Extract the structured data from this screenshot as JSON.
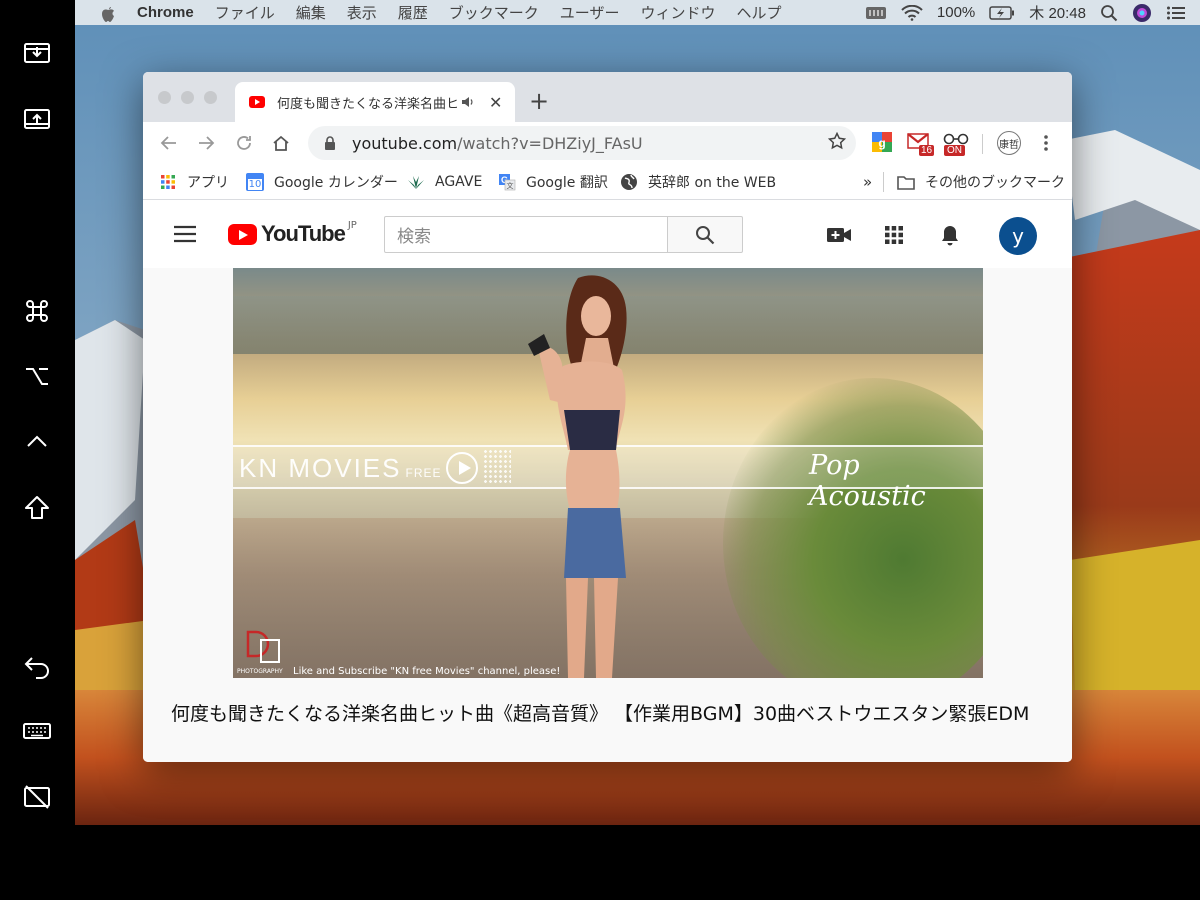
{
  "menubar": {
    "app_name": "Chrome",
    "menus": [
      "ファイル",
      "編集",
      "表示",
      "履歴",
      "ブックマーク",
      "ユーザー",
      "ウィンドウ",
      "ヘルプ"
    ],
    "battery": "100%",
    "clock": "木 20:48"
  },
  "tab": {
    "title": "何度も聞きたくなる洋楽名曲ヒ"
  },
  "omnibox": {
    "host": "youtube.com",
    "path": "/watch?v=DHZiyJ_FAsU"
  },
  "extensions": {
    "gmail_badge": "16",
    "toggle_badge": "ON",
    "profile": "康哲"
  },
  "bookmarks": {
    "items": [
      "アプリ",
      "Google カレンダー",
      "AGAVE",
      "Google 翻訳",
      "英辞郎 on the WEB"
    ],
    "calendar_day": "10",
    "overflow": "»",
    "other": "その他のブックマーク"
  },
  "youtube": {
    "logo_word": "YouTube",
    "region": "JP",
    "search_placeholder": "検索",
    "avatar_letter": "y"
  },
  "video": {
    "brand": "KN MOVIES",
    "brand_suffix": "FREE",
    "genre": "Pop Acoustic",
    "subscribe_text": "Like and Subscribe \"KN free Movies\" channel, please!",
    "photo_credit": "PHOTOGRAPHY",
    "title": "何度も聞きたくなる洋楽名曲ヒット曲《超高音質》 【作業用BGM】30曲ベストウエスタン緊張EDM"
  },
  "colors": {
    "youtube_red": "#ff0000",
    "avatar_bg": "#0b4f8f"
  },
  "icons": [
    "import-icon",
    "export-icon",
    "command-key-icon",
    "option-key-icon",
    "control-key-icon",
    "shift-key-icon",
    "undo-icon",
    "keyboard-icon",
    "disconnect-display-icon"
  ]
}
